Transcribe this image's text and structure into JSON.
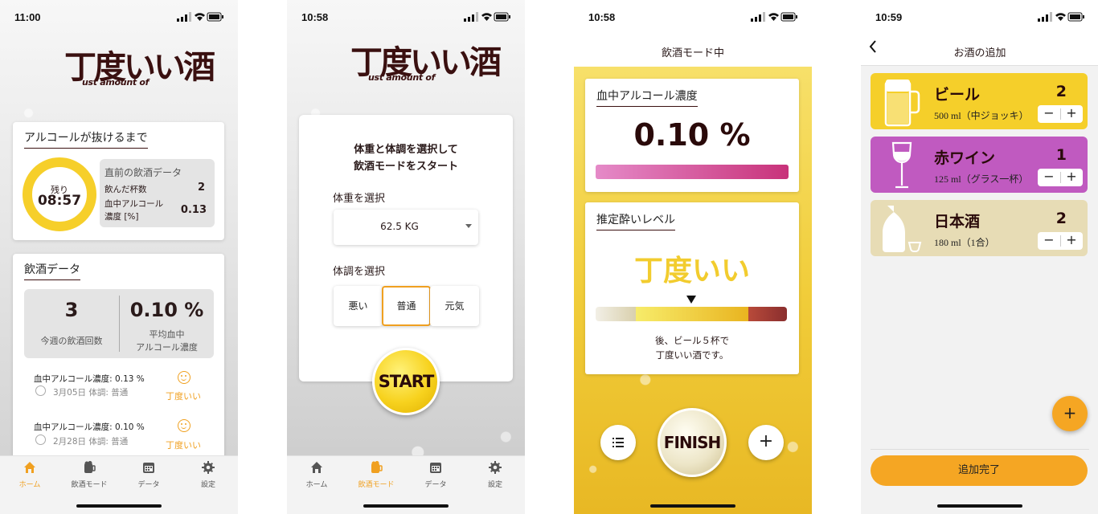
{
  "screen1": {
    "time": "11:00",
    "logo": {
      "big": "丁度いい酒",
      "small": "ust amount of"
    },
    "alcohol_section": {
      "title": "アルコールが抜けるまで",
      "remaining_label": "残り",
      "remaining_time": "08:57",
      "prev_title": "直前の飲酒データ",
      "cups_label": "飲んだ杯数",
      "cups_value": "2",
      "bac_label_1": "血中アルコール",
      "bac_label_2": "濃度 [%]",
      "bac_value": "0.13"
    },
    "drink_data": {
      "title": "飲酒データ",
      "week_count": "3",
      "week_label": "今週の飲酒回数",
      "avg_value": "0.10 %",
      "avg_label_1": "平均血中",
      "avg_label_2": "アルコール濃度",
      "history": [
        {
          "bac": "血中アルコール濃度: 0.13 %",
          "meta": "3月05日 体調: 普通",
          "status": "丁度いい"
        },
        {
          "bac": "血中アルコール濃度: 0.10 %",
          "meta": "2月28日 体調: 普通",
          "status": "丁度いい"
        }
      ]
    }
  },
  "tabs": [
    {
      "label": "ホーム",
      "icon": "home-icon"
    },
    {
      "label": "飲酒モード",
      "icon": "beer-mug-icon"
    },
    {
      "label": "データ",
      "icon": "calendar-icon"
    },
    {
      "label": "設定",
      "icon": "gear-icon"
    }
  ],
  "screen2": {
    "time": "10:58",
    "logo": {
      "big": "丁度いい酒",
      "small": "ust amount of"
    },
    "heading_1": "体重と体調を選択して",
    "heading_2": "飲酒モードをスタート",
    "weight_label": "体重を選択",
    "weight_value": "62.5 KG",
    "condition_label": "体調を選択",
    "conditions": [
      "悪い",
      "普通",
      "元気"
    ],
    "selected_condition": "普通",
    "start_label": "START"
  },
  "screen3": {
    "time": "10:58",
    "header": "飲酒モード中",
    "bac_title": "血中アルコール濃度",
    "bac_value": "0.10 %",
    "level_title": "推定酔いレベル",
    "level_value": "丁度いい",
    "advice_1": "後、ビール５杯で",
    "advice_2": "丁度いい酒です。",
    "finish_label": "FINISH",
    "colors": {
      "yellow": "#f2c62a",
      "pink": "#c8327a",
      "gauge_red": "#9a3a3a"
    }
  },
  "screen4": {
    "time": "10:59",
    "header": "お酒の追加",
    "drinks": [
      {
        "name": "ビール",
        "desc": "500 ml（中ジョッキ）",
        "count": "2",
        "color": "#f5cf2a",
        "icon": "beer-mug-icon"
      },
      {
        "name": "赤ワイン",
        "desc": "125 ml（グラス一杯）",
        "count": "1",
        "color": "#c05ac0",
        "icon": "wine-glass-icon"
      },
      {
        "name": "日本酒",
        "desc": "180 ml（1合）",
        "count": "2",
        "color": "#e7dcb5",
        "icon": "sake-bottle-icon"
      }
    ],
    "stepper_minus": "−",
    "stepper_plus": "+",
    "fab_label": "+",
    "done_label": "追加完了"
  }
}
